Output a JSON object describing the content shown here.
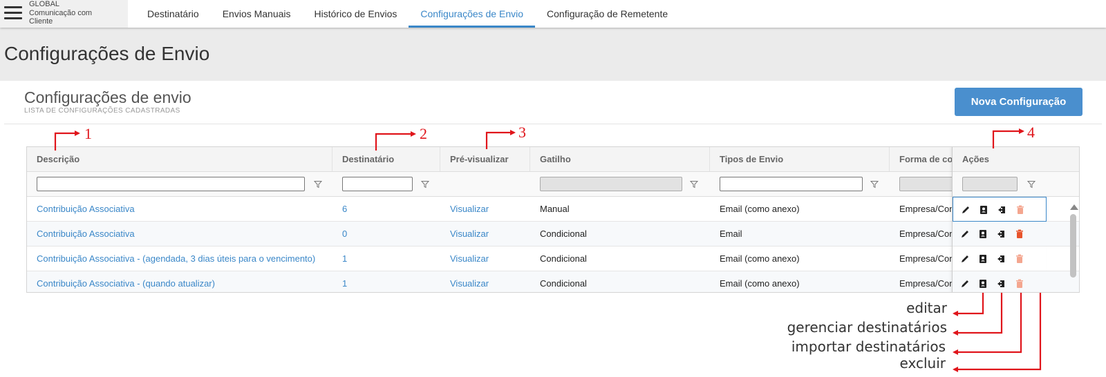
{
  "brand": {
    "line1": "GLOBAL",
    "line2": "Comunicação com",
    "line3": "Cliente"
  },
  "nav": {
    "items": [
      {
        "label": "Destinatário"
      },
      {
        "label": "Envios Manuais"
      },
      {
        "label": "Histórico de Envios"
      },
      {
        "label": "Configurações de Envio"
      },
      {
        "label": "Configuração de Remetente"
      }
    ],
    "active_index": 3
  },
  "page": {
    "title": "Configurações de Envio"
  },
  "card": {
    "title": "Configurações de envio",
    "subtitle": "LISTA DE CONFIGURAÇÕES CADASTRADAS",
    "new_button": "Nova Configuração"
  },
  "grid": {
    "columns": [
      "Descrição",
      "Destinatário",
      "Pré-visualizar",
      "Gatilho",
      "Tipos de Envio",
      "Forma de co",
      "Ações"
    ],
    "rows": [
      {
        "descricao": "Contribuição Associativa",
        "destinatario": "6",
        "previsualizar": "Visualizar",
        "gatilho": "Manual",
        "tipos": "Email (como anexo)",
        "forma": "Empresa/Con"
      },
      {
        "descricao": "Contribuição Associativa",
        "destinatario": "0",
        "previsualizar": "Visualizar",
        "gatilho": "Condicional",
        "tipos": "Email",
        "forma": "Empresa/Con"
      },
      {
        "descricao": "Contribuição Associativa - (agendada, 3 dias úteis para o vencimento)",
        "destinatario": "1",
        "previsualizar": "Visualizar",
        "gatilho": "Condicional",
        "tipos": "Email (como anexo)",
        "forma": "Empresa/Con"
      },
      {
        "descricao": "Contribuição Associativa - (quando atualizar)",
        "destinatario": "1",
        "previsualizar": "Visualizar",
        "gatilho": "Condicional",
        "tipos": "Email (como anexo)",
        "forma": "Empresa/Con"
      }
    ]
  },
  "annotations": {
    "numbers": [
      "1",
      "2",
      "3",
      "4"
    ],
    "legend": [
      "editar",
      "gerenciar destinatários",
      "importar destinatários",
      "excluir"
    ]
  },
  "colors": {
    "accent": "#3a87c8",
    "button": "#4a8fce",
    "annotation": "#e0151b",
    "delete_active": "#e8542c",
    "delete_muted": "#f4a68f"
  },
  "icons": {
    "menu": "hamburger-icon",
    "filter": "funnel-icon",
    "edit": "pencil-icon",
    "manage": "contact-book-icon",
    "import": "import-icon",
    "delete": "trash-icon"
  }
}
